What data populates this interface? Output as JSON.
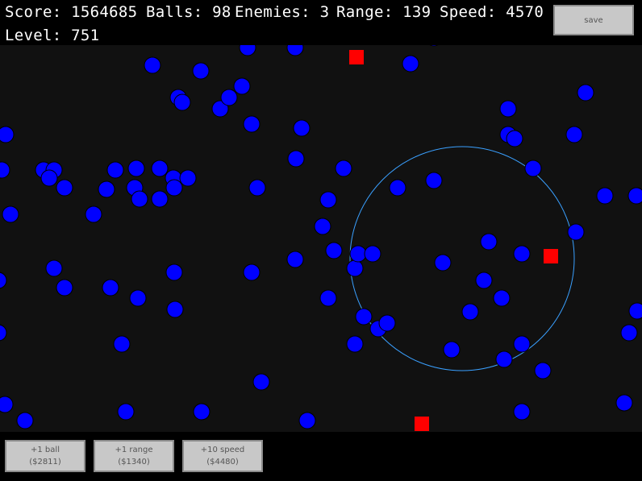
{
  "hud": {
    "score_text": "Score: 1564685",
    "balls_text": "Balls: 98",
    "enemies_text": "Enemies: 3",
    "range_text": "Range: 139",
    "speed_text": "Speed: 4570",
    "level_text": "Level: 751",
    "save_label": "save"
  },
  "shop": {
    "ball_label": "+1 ball",
    "ball_price": "($2811)",
    "range_label": "+1 range",
    "range_price": "($1340)",
    "speed_label": "+10 speed",
    "speed_price": "($4480)"
  },
  "colors": {
    "background": "#111111",
    "ball": "#0000ff",
    "enemy": "#ff0000",
    "range_ring": "#3aa0ff",
    "button": "#c8c8c8"
  }
}
